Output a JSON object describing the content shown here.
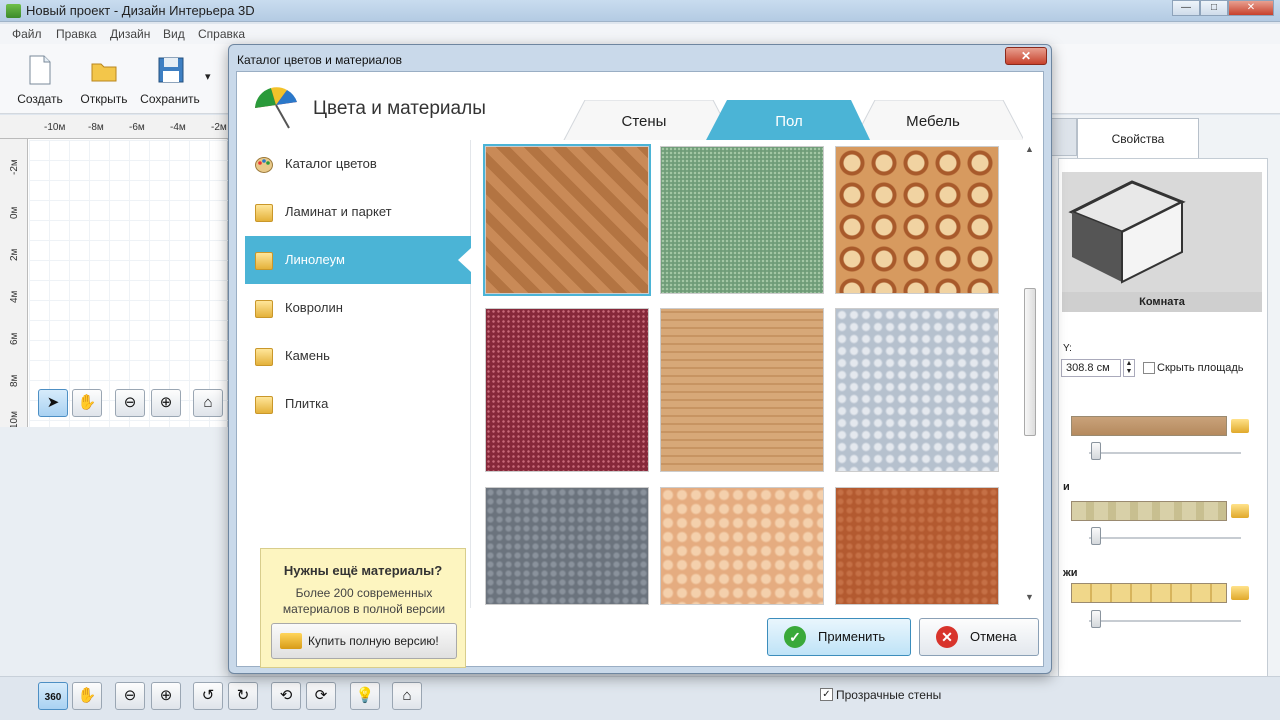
{
  "window": {
    "title": "Новый проект - Дизайн Интерьера 3D",
    "min": "—",
    "max": "□",
    "close": "✕"
  },
  "menu": [
    "Файл",
    "Правка",
    "Дизайн",
    "Вид",
    "Справка"
  ],
  "toolbar": {
    "create": "Создать",
    "open": "Открыть",
    "save": "Сохранить",
    "more": "▾"
  },
  "ruler": {
    "top": [
      "-10м",
      "-8м",
      "-6м",
      "-4м",
      "-2м"
    ],
    "left": [
      "-2м",
      "0м",
      "2м",
      "4м",
      "6м",
      "8м",
      "10м"
    ]
  },
  "right_panel": {
    "tab": "Свойства",
    "preview_caption": "Комната",
    "y_label": "Y:",
    "y_value": "308.8 см",
    "hide_area": "Скрыть площадь",
    "label2": "и",
    "label3": "жи"
  },
  "bottom": {
    "transparent_walls": "Прозрачные стены"
  },
  "dialog": {
    "title": "Каталог цветов и материалов",
    "close": "✕",
    "heading": "Цвета и материалы",
    "tabs": {
      "walls": "Стены",
      "floor": "Пол",
      "furniture": "Мебель"
    },
    "categories": [
      "Каталог цветов",
      "Ламинат и паркет",
      "Линолеум",
      "Ковролин",
      "Камень",
      "Плитка"
    ],
    "selected_category": "Линолеум",
    "promo": {
      "heading": "Нужны ещё материалы?",
      "text": "Более 200 современных материалов в полной версии",
      "button": "Купить полную версию!"
    },
    "apply": "Применить",
    "cancel": "Отмена"
  },
  "colors": {
    "accent": "#4bb4d6",
    "apply_icon": "#3aa93a",
    "cancel_icon": "#d8342c"
  }
}
